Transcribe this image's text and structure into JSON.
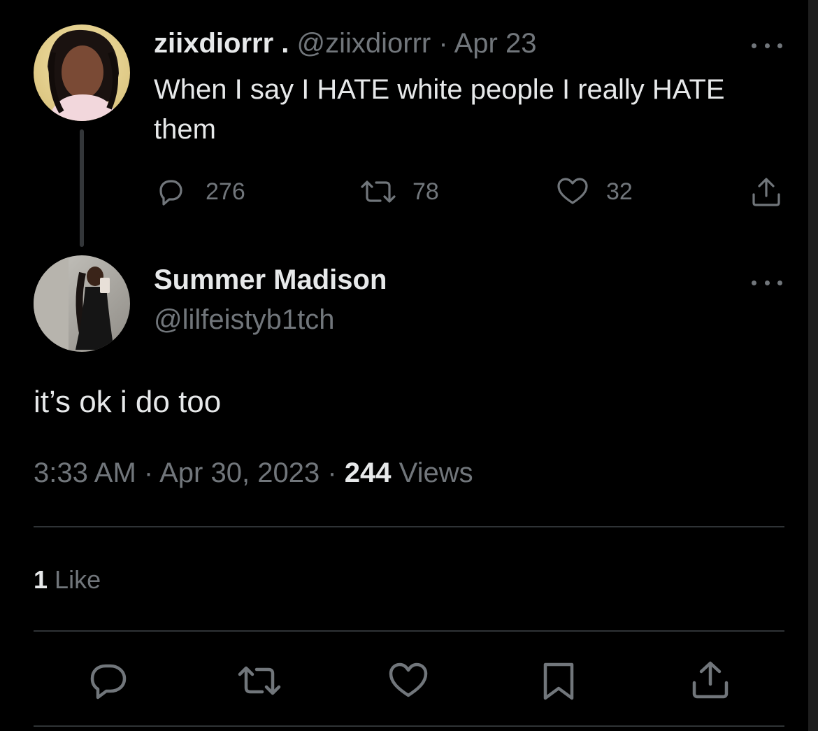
{
  "parent_tweet": {
    "display_name": "ziixdiorrr .",
    "handle": "@ziixdiorrr",
    "separator": "·",
    "date": "Apr 23",
    "text": "When I say I HATE white people I really HATE them",
    "replies": "276",
    "retweets": "78",
    "likes": "32"
  },
  "main_tweet": {
    "display_name": "Summer Madison",
    "handle": "@lilfeistyb1tch",
    "text": "it’s ok i do too",
    "time": "3:33 AM",
    "separator": "·",
    "date": "Apr 30, 2023",
    "views_count": "244",
    "views_label": "Views",
    "like_count": "1",
    "like_label": "Like"
  },
  "icons": {
    "reply": "reply-icon",
    "retweet": "retweet-icon",
    "like": "heart-icon",
    "share": "share-icon",
    "bookmark": "bookmark-icon",
    "more": "more-icon"
  },
  "colors": {
    "background": "#000000",
    "text": "#e7e9ea",
    "muted": "#71767b",
    "divider": "#2f3336"
  }
}
